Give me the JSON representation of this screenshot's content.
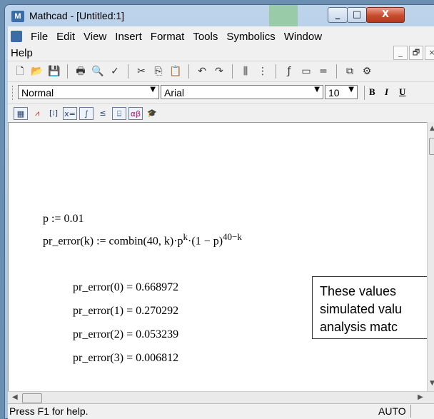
{
  "window": {
    "title": "Mathcad - [Untitled:1]",
    "app_icon": "mathcad-icon"
  },
  "title_buttons": {
    "minimize": "_",
    "maximize": "□",
    "close": "X"
  },
  "menu": {
    "items": [
      {
        "label": "File"
      },
      {
        "label": "Edit"
      },
      {
        "label": "View"
      },
      {
        "label": "Insert"
      },
      {
        "label": "Format"
      },
      {
        "label": "Tools"
      },
      {
        "label": "Symbolics"
      },
      {
        "label": "Window"
      }
    ],
    "help": "Help"
  },
  "mdi_buttons": {
    "minimize": "_",
    "restore": "🗗",
    "close": "×"
  },
  "toolbar_standard": {
    "icons": [
      "new-icon",
      "open-icon",
      "save-icon",
      "print-icon",
      "print-preview-icon",
      "spellcheck-icon",
      "cut-icon",
      "copy-icon",
      "paste-icon",
      "undo-icon",
      "redo-icon",
      "align-across-icon",
      "align-down-icon",
      "insert-function-icon",
      "insert-unit-icon",
      "calculate-icon",
      "resource-center-icon",
      "components-icon"
    ]
  },
  "toolbar_formatting": {
    "style": "Normal",
    "font": "Arial",
    "size": "10",
    "bold": "B",
    "italic": "I",
    "underline": "U"
  },
  "toolbar_math": {
    "icons": [
      "calculator-palette-icon",
      "graph-palette-icon",
      "matrix-palette-icon",
      "evaluation-palette-icon",
      "calculus-palette-icon",
      "boolean-palette-icon",
      "programming-palette-icon",
      "greek-palette-icon",
      "symbolic-palette-icon"
    ],
    "labels": {
      "evaluation": "x=",
      "greek": "αβ"
    }
  },
  "worksheet": {
    "definitions": [
      {
        "text": "p := 0.01"
      },
      {
        "lhs": "pr_error(k) := combin(40, k)·p",
        "exp1": "k",
        "mid": "·(1 − p)",
        "exp2": "40−k"
      }
    ],
    "results": [
      {
        "expr": "pr_error(0) = 0.668972"
      },
      {
        "expr": "pr_error(1) = 0.270292"
      },
      {
        "expr": "pr_error(2) = 0.053239"
      },
      {
        "expr": "pr_error(3) = 0.006812"
      }
    ],
    "callout_lines": [
      "These values",
      "simulated valu",
      "analysis matc"
    ]
  },
  "status": {
    "help_text": "Press F1 for help.",
    "mode": "AUTO"
  }
}
